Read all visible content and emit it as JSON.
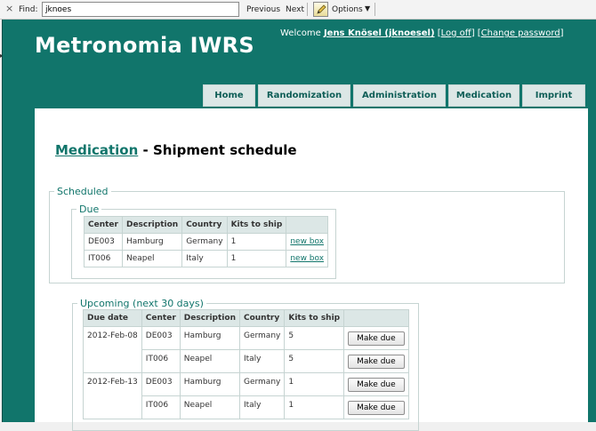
{
  "findbar": {
    "close_glyph": "×",
    "label": "Find:",
    "query": "jknoes",
    "previous": "Previous",
    "next": "Next",
    "options": "Options",
    "options_caret": "▼",
    "edge_glyph": "▸"
  },
  "app": {
    "title": "Metronomia IWRS",
    "welcome": "Welcome",
    "user": "Jens Knösel (jknoesel)",
    "bracket_open": "[",
    "bracket_close": "]",
    "logoff": "Log off",
    "change_password": "Change password"
  },
  "nav": {
    "items": [
      {
        "label": "Home"
      },
      {
        "label": "Randomization"
      },
      {
        "label": "Administration"
      },
      {
        "label": "Medication"
      },
      {
        "label": "Imprint"
      }
    ]
  },
  "page": {
    "breadcrumb_link": "Medication",
    "separator": " - ",
    "title": "Shipment schedule"
  },
  "scheduled": {
    "legend": "Scheduled",
    "due": {
      "legend": "Due",
      "columns": [
        "Center",
        "Description",
        "Country",
        "Kits to ship",
        ""
      ],
      "rows": [
        {
          "center": "DE003",
          "description": "Hamburg",
          "country": "Germany",
          "kits": "1",
          "action": "new box"
        },
        {
          "center": "IT006",
          "description": "Neapel",
          "country": "Italy",
          "kits": "1",
          "action": "new box"
        }
      ]
    }
  },
  "upcoming": {
    "legend": "Upcoming (next 30 days)",
    "columns": [
      "Due date",
      "Center",
      "Description",
      "Country",
      "Kits to ship",
      ""
    ],
    "rows": [
      {
        "due_date": "2012-Feb-08",
        "center": "DE003",
        "description": "Hamburg",
        "country": "Germany",
        "kits": "5",
        "action": "Make due"
      },
      {
        "due_date": "",
        "center": "IT006",
        "description": "Neapel",
        "country": "Italy",
        "kits": "5",
        "action": "Make due"
      },
      {
        "due_date": "2012-Feb-13",
        "center": "DE003",
        "description": "Hamburg",
        "country": "Germany",
        "kits": "1",
        "action": "Make due"
      },
      {
        "due_date": "",
        "center": "IT006",
        "description": "Neapel",
        "country": "Italy",
        "kits": "1",
        "action": "Make due"
      }
    ]
  },
  "colors": {
    "brand": "#11756b",
    "nav_tab_bg": "#dce7e6",
    "table_header_bg": "#dce7e6",
    "border": "#c6d4d2"
  }
}
